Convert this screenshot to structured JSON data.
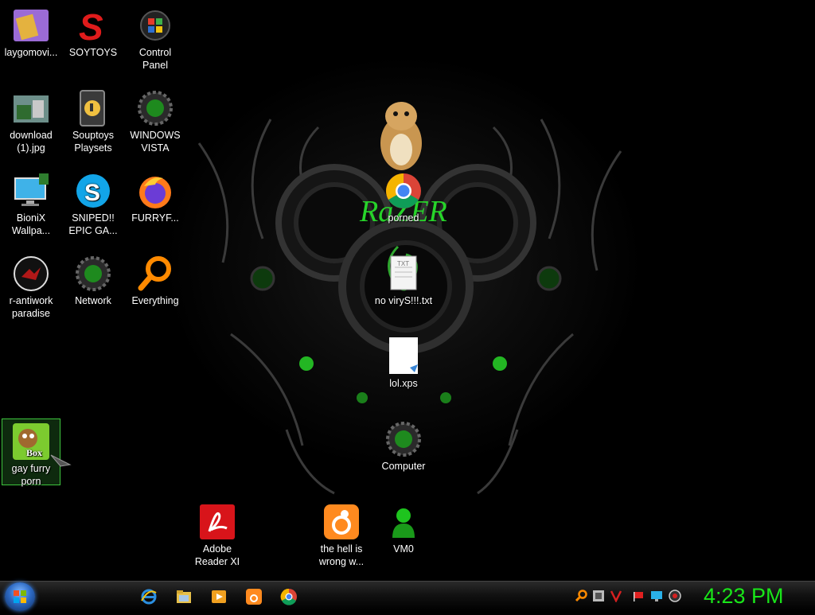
{
  "desktop": {
    "icons": [
      {
        "label": "laygomovi..."
      },
      {
        "label": "SOYTOYS"
      },
      {
        "label": "Control\nPanel"
      },
      {
        "label": "download\n(1).jpg"
      },
      {
        "label": "Souptoys\nPlaysets"
      },
      {
        "label": "WINDOWS\nVISTA"
      },
      {
        "label": "BioniX\nWallpa..."
      },
      {
        "label": "SNIPED!!\nEPIC GA..."
      },
      {
        "label": "FURRYF..."
      },
      {
        "label": "r-antiwork\nparadise"
      },
      {
        "label": "Network"
      },
      {
        "label": "Everything"
      },
      {
        "label": "gay furry\nporn",
        "badge": "Box"
      },
      {
        "label": "porned"
      },
      {
        "label": "no viryS!!!.txt",
        "file_tag": "TXT"
      },
      {
        "label": "lol.xps"
      },
      {
        "label": "Computer"
      },
      {
        "label": "Adobe\nReader XI"
      },
      {
        "label": "the hell is\nwrong w..."
      },
      {
        "label": "VM0"
      }
    ],
    "wallpaper": {
      "brand_text": "RaZER",
      "accent_color": "#27d42a"
    }
  },
  "taskbar": {
    "start_button": {
      "icon": "windows-logo-icon"
    },
    "pinned": [
      "internet-explorer-icon",
      "file-explorer-icon",
      "media-player-icon",
      "uc-browser-icon",
      "chrome-icon"
    ],
    "tray": [
      "everything-search-icon",
      "network-monitor-icon",
      "razer-tray-icon",
      "flag-icon",
      "monitor-icon",
      "speaker-icon"
    ],
    "clock": "4:23 PM",
    "clock_color": "#19e619"
  }
}
